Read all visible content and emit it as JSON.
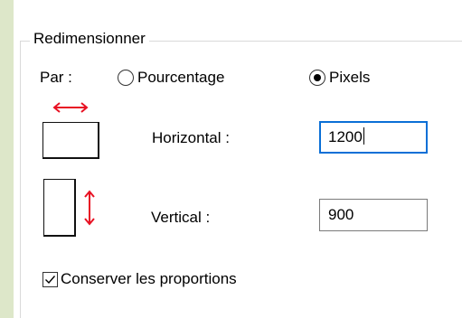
{
  "resize": {
    "title": "Redimensionner",
    "by_label": "Par :",
    "options": [
      {
        "label": "Pourcentage",
        "selected": false
      },
      {
        "label": "Pixels",
        "selected": true
      }
    ],
    "horizontal": {
      "label": "Horizontal :",
      "value": "1200"
    },
    "vertical": {
      "label": "Vertical :",
      "value": "900"
    },
    "keep_ratio": {
      "label": "Conserver les proportions",
      "checked": true
    }
  },
  "colors": {
    "accent_red": "#e81123",
    "focus_blue": "#0a6fd6",
    "side_bg": "#dde7c9"
  },
  "icons": [
    "horizontal-resize-icon",
    "vertical-resize-icon"
  ]
}
